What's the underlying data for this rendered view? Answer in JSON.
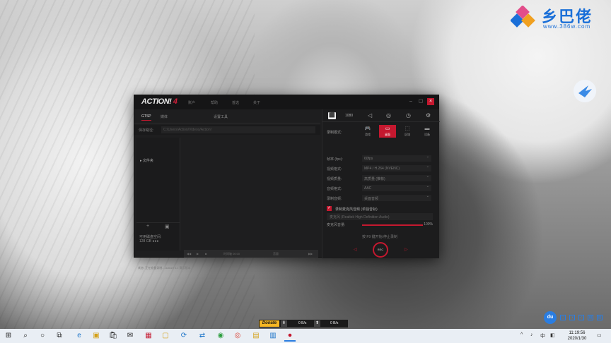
{
  "watermark": {
    "brand": "乡巴佬",
    "url": "www.386w.com"
  },
  "app": {
    "logo_main": "ACTION!",
    "logo_suffix": "4",
    "menu": [
      "账户",
      "帮助",
      "首选",
      "关于"
    ],
    "tabs": [
      "GTSP",
      "媒体",
      "设置工具"
    ],
    "path_label": "保存路径:",
    "path_value": "C:/Users/Action/Videos/Action!",
    "tree_node": "▸ 文件夹",
    "storage_line1": "可用磁盘空间:",
    "storage_line2": "128 GB  ●●●",
    "player_segments": [
      "◀◀",
      "▶",
      "■",
      "时间轴 00:00",
      "音量",
      "▶▶"
    ],
    "status_text": "状态: 正在准备录制...  Action! 4.x 演示版本",
    "top_icons": [
      "⬛",
      "1080",
      "◁",
      "◎",
      "◷",
      "⚙"
    ],
    "mode_label": "录制模式:",
    "modes": [
      {
        "icon": "🎮",
        "text": "游戏"
      },
      {
        "icon": "▭",
        "text": "桌面"
      },
      {
        "icon": "⬚",
        "text": "区域"
      },
      {
        "icon": "▬",
        "text": "设备"
      }
    ],
    "rows": [
      {
        "key": "帧率 (fps):",
        "value": "60fps"
      },
      {
        "key": "视频格式:",
        "value": "MP4 / H.264 (NVENC)"
      },
      {
        "key": "视频质量:",
        "value": "高质量 (推荐)"
      },
      {
        "key": "音频格式:",
        "value": "AAC"
      },
      {
        "key": "录制音频:",
        "value": "桌面音频"
      }
    ],
    "check_label": "录制麦克风音频 (单独音轨)",
    "sub_value": "麦克风 (Realtek High Definition Audio)",
    "volume_label": "麦克风音量:",
    "volume_pct": "100%",
    "volume_level": 1.0,
    "hint": "按 F9 键开始/停止录制",
    "rec_label": "REC"
  },
  "donate": {
    "button": "Donate",
    "down_rate": "0 B/s",
    "up_rate": "0 B/s"
  },
  "tray": {
    "du_label": "du"
  },
  "taskbar": {
    "time": "11:19:56",
    "date": "2020/1/30",
    "apps": [
      "⊞",
      "⌕",
      "○",
      "⧉",
      "e",
      "▣",
      "🛍",
      "✉",
      "▦",
      "▢",
      "⟳",
      "⇄",
      "◉",
      "◎",
      "▤",
      "▥",
      "⏺"
    ],
    "tray_icons": [
      "^",
      "♪",
      "中",
      "◧"
    ]
  },
  "colors": {
    "accent": "#c4182f",
    "brand": "#1a6fd8",
    "donate": "#f5b623"
  }
}
